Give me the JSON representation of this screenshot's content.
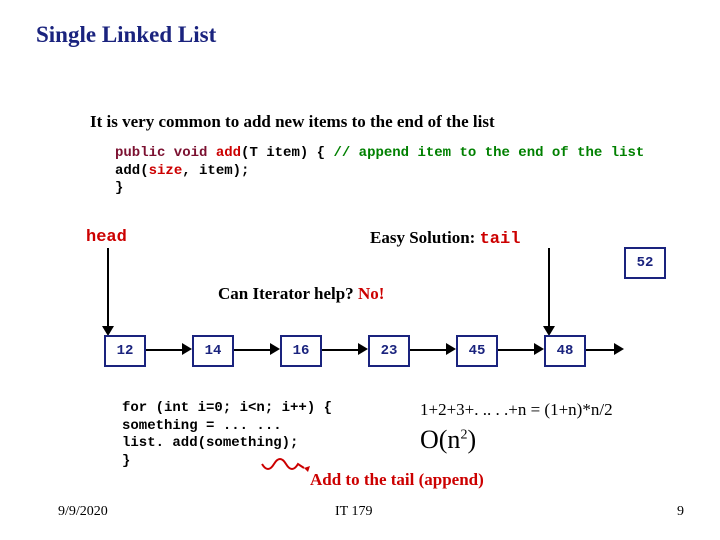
{
  "title": "Single Linked List",
  "intro": "It is very common to add new items to the end of the list",
  "code_top": {
    "sig_prefix": "public void ",
    "sig_name": "add",
    "sig_params": "(T item) { ",
    "comment": "// append item to the end of the list",
    "body_indent": "        ",
    "body_call": "add(",
    "body_arg1": "size",
    "body_rest": ", item);",
    "close": "}"
  },
  "head_label": "head",
  "easy_prefix": "Easy Solution:  ",
  "tail_label": "tail",
  "extra_node": "52",
  "can_iter_q": "Can Iterator help?  ",
  "can_iter_a": "No!",
  "nodes": [
    "12",
    "14",
    "16",
    "23",
    "45",
    "48"
  ],
  "code_bottom": {
    "line1": "for (int i=0; i<n; i++) {",
    "line2": "        something = ... ...",
    "line3": "        list. add(something);",
    "close": "}"
  },
  "sum_formula": "1+2+3+. .. . .+n = (1+n)*n/2",
  "bigO_open": "O(n",
  "bigO_exp": "2",
  "bigO_close": ")",
  "add_tail": "Add to the tail (append)",
  "footer_date": "9/9/2020",
  "footer_mid": "IT 179",
  "footer_page": "9"
}
